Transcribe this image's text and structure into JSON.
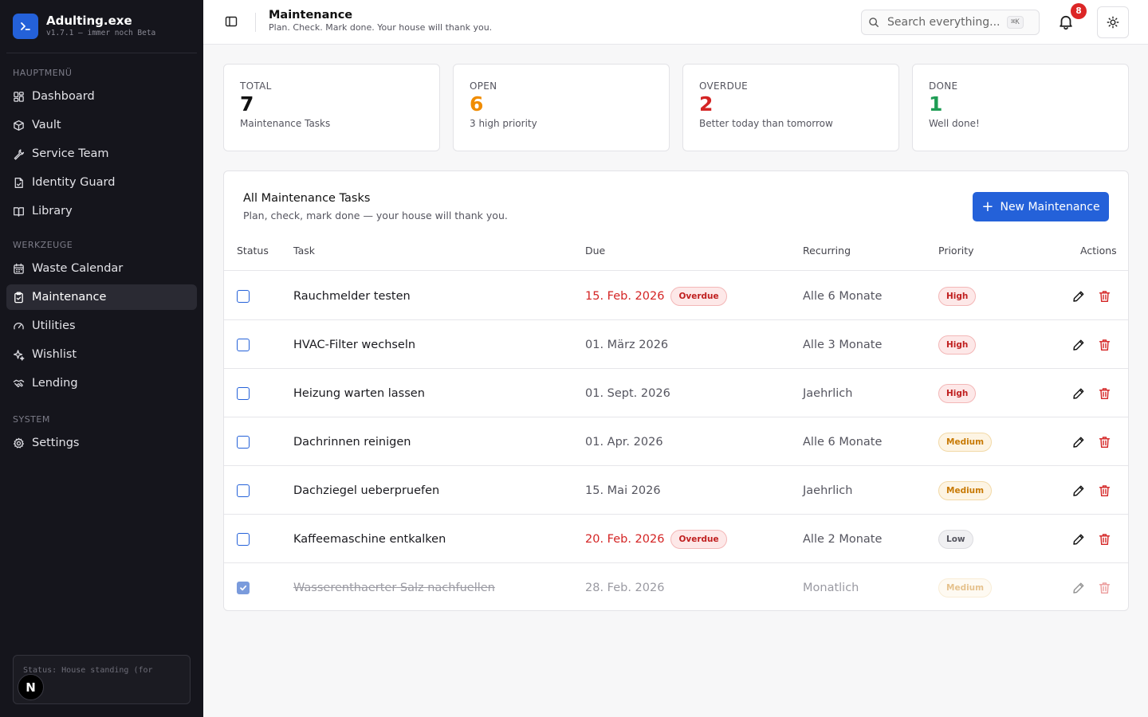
{
  "app": {
    "name": "Adulting.exe",
    "version": "v1.7.1 — immer noch Beta",
    "status_text": "Status: House standing (for",
    "avatar_letter": "N"
  },
  "sidebar": {
    "sections": [
      {
        "title": "HAUPTMENÜ",
        "items": [
          {
            "label": "Dashboard",
            "icon": "dashboard-icon"
          },
          {
            "label": "Vault",
            "icon": "box-icon"
          },
          {
            "label": "Service Team",
            "icon": "wrench-icon"
          },
          {
            "label": "Identity Guard",
            "icon": "document-icon"
          },
          {
            "label": "Library",
            "icon": "book-icon"
          }
        ]
      },
      {
        "title": "WERKZEUGE",
        "items": [
          {
            "label": "Waste Calendar",
            "icon": "calendar-icon"
          },
          {
            "label": "Maintenance",
            "icon": "clipboard-icon",
            "active": true
          },
          {
            "label": "Utilities",
            "icon": "gauge-icon"
          },
          {
            "label": "Wishlist",
            "icon": "sparkle-icon"
          },
          {
            "label": "Lending",
            "icon": "handshake-icon"
          }
        ]
      },
      {
        "title": "SYSTEM",
        "items": [
          {
            "label": "Settings",
            "icon": "gear-icon"
          }
        ]
      }
    ]
  },
  "header": {
    "title": "Maintenance",
    "subtitle": "Plan. Check. Mark done. Your house will thank you.",
    "search_placeholder": "Search everything...",
    "search_shortcut": "⌘K",
    "notification_count": "8"
  },
  "stats": [
    {
      "label": "TOTAL",
      "value": "7",
      "desc": "Maintenance Tasks",
      "color": "#111111"
    },
    {
      "label": "OPEN",
      "value": "6",
      "desc": "3 high priority",
      "color": "#f08c00"
    },
    {
      "label": "OVERDUE",
      "value": "2",
      "desc": "Better today than tomorrow",
      "color": "#d42424"
    },
    {
      "label": "DONE",
      "value": "1",
      "desc": "Well done!",
      "color": "#1f9d55"
    }
  ],
  "tasks_card": {
    "title": "All Maintenance Tasks",
    "subtitle": "Plan, check, mark done — your house will thank you.",
    "new_button": "New Maintenance",
    "columns": [
      "Status",
      "Task",
      "Due",
      "Recurring",
      "Priority",
      "Actions"
    ],
    "overdue_label": "Overdue",
    "rows": [
      {
        "task": "Rauchmelder testen",
        "due": "15. Feb. 2026",
        "overdue": true,
        "recurring": "Alle 6 Monate",
        "priority": "High",
        "done": false
      },
      {
        "task": "HVAC-Filter wechseln",
        "due": "01. März 2026",
        "overdue": false,
        "recurring": "Alle 3 Monate",
        "priority": "High",
        "done": false
      },
      {
        "task": "Heizung warten lassen",
        "due": "01. Sept. 2026",
        "overdue": false,
        "recurring": "Jaehrlich",
        "priority": "High",
        "done": false
      },
      {
        "task": "Dachrinnen reinigen",
        "due": "01. Apr. 2026",
        "overdue": false,
        "recurring": "Alle 6 Monate",
        "priority": "Medium",
        "done": false
      },
      {
        "task": "Dachziegel ueberpruefen",
        "due": "15. Mai 2026",
        "overdue": false,
        "recurring": "Jaehrlich",
        "priority": "Medium",
        "done": false
      },
      {
        "task": "Kaffeemaschine entkalken",
        "due": "20. Feb. 2026",
        "overdue": true,
        "recurring": "Alle 2 Monate",
        "priority": "Low",
        "done": false
      },
      {
        "task": "Wasserenthaerter Salz nachfuellen",
        "due": "28. Feb. 2026",
        "overdue": false,
        "recurring": "Monatlich",
        "priority": "Medium",
        "done": true
      }
    ]
  }
}
